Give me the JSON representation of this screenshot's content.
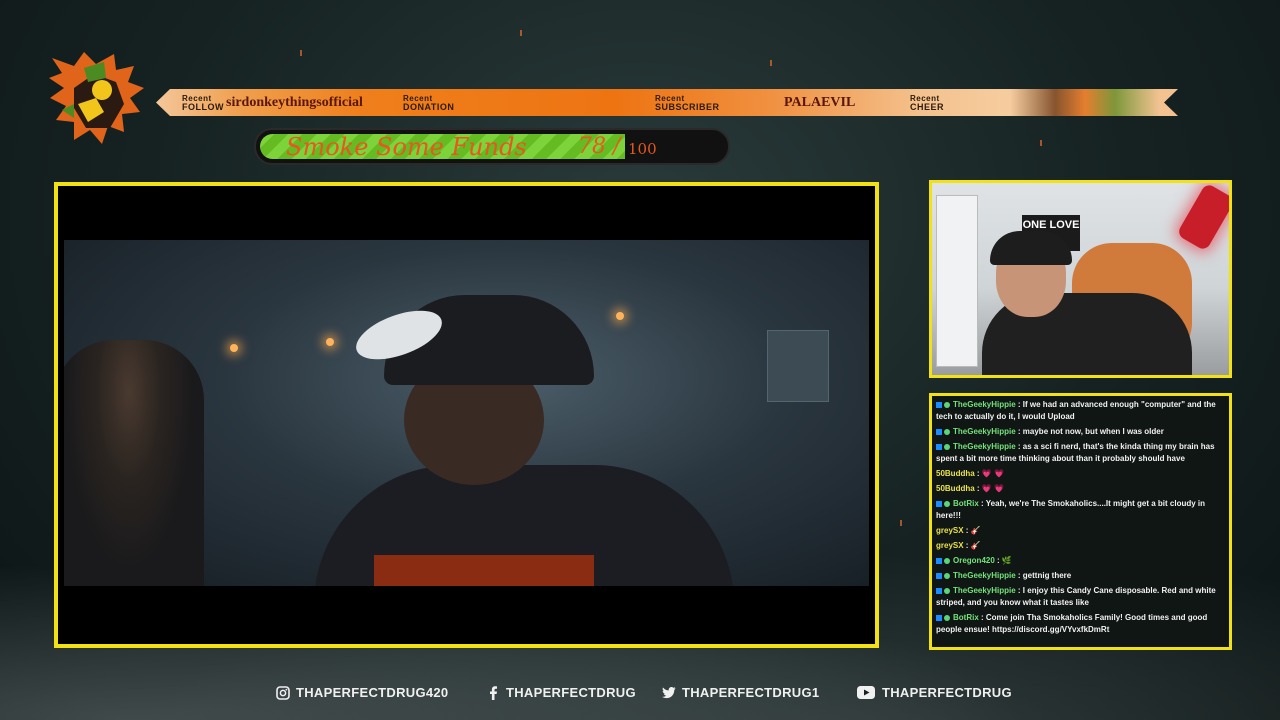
{
  "banner": {
    "follow": {
      "label_top": "Recent",
      "label_bottom": "FOLLOW",
      "value": "sirdonkeythingsofficial"
    },
    "donation": {
      "label_top": "Recent",
      "label_bottom": "DONATION",
      "value": ""
    },
    "subscriber": {
      "label_top": "Recent",
      "label_bottom": "SUBSCRIBER",
      "value": "PALAEVIL"
    },
    "cheer": {
      "label_top": "Recent",
      "label_bottom": "CHEER",
      "value": ""
    }
  },
  "goal": {
    "label": "Smoke Some Funds",
    "current": "78",
    "separator": "/",
    "total": "100",
    "progress": 0.78
  },
  "webcam": {
    "banner_text": "ONE LOVE"
  },
  "chat": [
    {
      "user": "TheGeekyHippie",
      "text": "If we had an advanced enough \"computer\" and the tech to actually do it, I would Upload"
    },
    {
      "user": "TheGeekyHippie",
      "text": "maybe not now, but when I was older"
    },
    {
      "user": "TheGeekyHippie",
      "text": "as a sci fi nerd, that's the kinda thing my brain has spent a bit more time thinking about than it probably should have"
    },
    {
      "user": "50Buddha",
      "text": "💗 💗"
    },
    {
      "user": "50Buddha",
      "text": "💗 💗"
    },
    {
      "user": "BotRix",
      "text": "Yeah, we're The Smokaholics....It might get a bit cloudy in here!!!"
    },
    {
      "user": "greySX",
      "text": "🎸"
    },
    {
      "user": "greySX",
      "text": "🎸"
    },
    {
      "user": "Oregon420",
      "text": "🌿"
    },
    {
      "user": "TheGeekyHippie",
      "text": "gettnig there"
    },
    {
      "user": "TheGeekyHippie",
      "text": "I enjoy this Candy Cane disposable. Red and white striped, and you know what it tastes like"
    },
    {
      "user": "BotRix",
      "text": "Come join Tha Smokaholics Family! Good times and good people ensue! https://discord.gg/VYvxfkDmRt"
    }
  ],
  "socials": {
    "instagram": "THAPERFECTDRUG420",
    "facebook": "THAPERFECTDRUG",
    "twitter": "THAPERFECTDRUG1",
    "youtube": "THAPERFECTDRUG"
  },
  "colors": {
    "frame": "#f2e214",
    "accent": "#ee7412",
    "goal_fill": "#7cd33a"
  }
}
